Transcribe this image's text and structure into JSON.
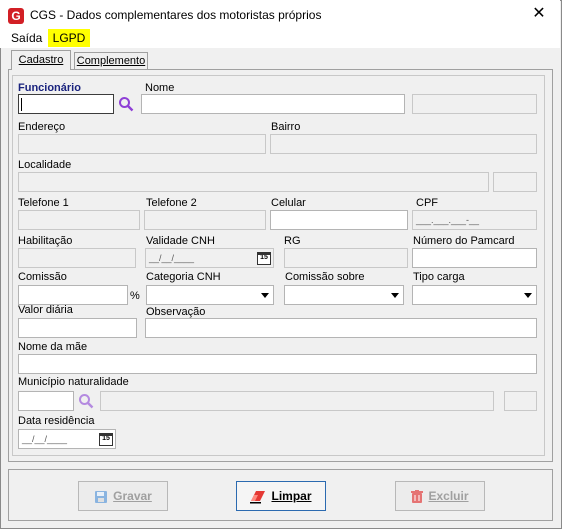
{
  "window": {
    "title": "CGS - Dados complementares dos motoristas próprios",
    "close": "✕"
  },
  "menu": {
    "saida": "Saída",
    "lgpd": "LGPD",
    "lgpd_color": "#ffff00"
  },
  "tabs": [
    {
      "label": "Cadastro",
      "active": true
    },
    {
      "label": "Complemento",
      "active": false
    }
  ],
  "fields": {
    "funcionario": {
      "label": "Funcionário",
      "value": ""
    },
    "nome": {
      "label": "Nome",
      "value": ""
    },
    "endereco": {
      "label": "Endereço",
      "value": ""
    },
    "bairro": {
      "label": "Bairro",
      "value": ""
    },
    "localidade": {
      "label": "Localidade",
      "value": ""
    },
    "telefone1": {
      "label": "Telefone 1",
      "value": ""
    },
    "telefone2": {
      "label": "Telefone 2",
      "value": ""
    },
    "celular": {
      "label": "Celular",
      "value": ""
    },
    "cpf": {
      "label": "CPF",
      "mask": "___.___.___-__"
    },
    "habilitacao": {
      "label": "Habilitação",
      "value": ""
    },
    "validade_cnh": {
      "label": "Validade CNH",
      "mask": "__/__/____"
    },
    "rg": {
      "label": "RG",
      "value": ""
    },
    "numero_pamcard": {
      "label": "Número do Pamcard",
      "value": ""
    },
    "comissao": {
      "label": "Comissão",
      "value": "",
      "unit": "%"
    },
    "categoria_cnh": {
      "label": "Categoria CNH",
      "value": ""
    },
    "comissao_sobre": {
      "label": "Comissão sobre",
      "value": ""
    },
    "tipo_carga": {
      "label": "Tipo carga",
      "value": ""
    },
    "valor_diaria": {
      "label": "Valor diária",
      "value": ""
    },
    "observacao": {
      "label": "Observação",
      "value": ""
    },
    "nome_mae": {
      "label": "Nome da mãe",
      "value": ""
    },
    "municipio_naturalidade": {
      "label": "Município naturalidade",
      "value": ""
    },
    "data_residencia": {
      "label": "Data residência",
      "mask": "__/__/____"
    }
  },
  "calendar_icon_text": "15",
  "buttons": {
    "gravar": {
      "label": "Gravar",
      "enabled": false
    },
    "limpar": {
      "label": "Limpar",
      "enabled": true
    },
    "excluir": {
      "label": "Excluir",
      "enabled": false
    }
  },
  "colors": {
    "search_icon": "#8e3fd6",
    "funcionario_label": "#1a237e",
    "app_icon": "#d21f25"
  }
}
